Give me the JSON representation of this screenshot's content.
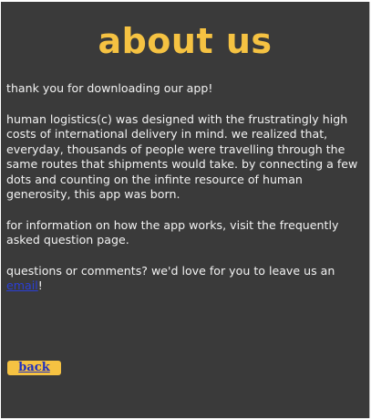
{
  "header": {
    "title": "about us"
  },
  "content": {
    "paragraph_1": "thank you for downloading our app!",
    "paragraph_2": "human logistics(c) was designed with the frustratingly high costs of international delivery in mind. we realized that, everyday, thousands of people were travelling through the same routes that shipments would take. by connecting a few dots and counting on the infinte resource of human generosity, this app was born.",
    "paragraph_3": "for information on how the app works, visit the frequently asked question page.",
    "paragraph_4_before_link": "questions or comments? we'd love for you to leave us an ",
    "email_link_label": "email",
    "paragraph_4_after_link": "!"
  },
  "footer": {
    "back_label": "back"
  },
  "colors": {
    "background": "#3a3a3a",
    "accent": "#f5c242",
    "text": "#f2f2f2",
    "link": "#2b3fd6"
  }
}
